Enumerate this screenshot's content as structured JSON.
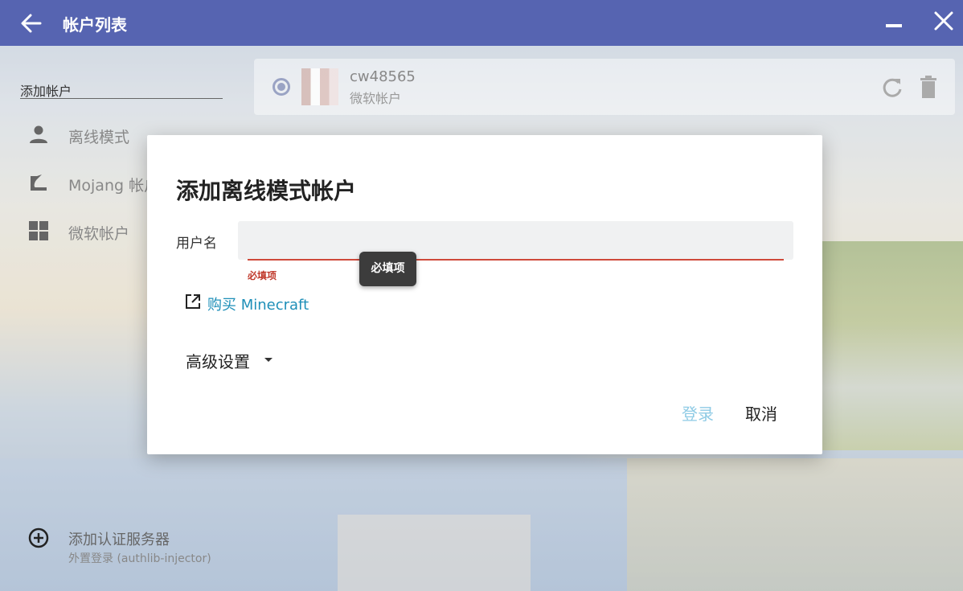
{
  "titlebar": {
    "title": "帐户列表"
  },
  "sidebar": {
    "add_account_label": "添加帐户",
    "items": [
      {
        "label": "离线模式",
        "icon": "person-icon"
      },
      {
        "label": "Mojang 帐户",
        "icon": "mojang-icon"
      },
      {
        "label": "微软帐户",
        "icon": "windows-icon"
      }
    ],
    "add_server": {
      "label": "添加认证服务器",
      "sublabel": "外置登录 (authlib-injector)",
      "icon": "add-circle-icon"
    }
  },
  "account": {
    "name": "cw48565",
    "type": "微软帐户"
  },
  "dialog": {
    "title": "添加离线模式帐户",
    "username_label": "用户名",
    "username_value": "",
    "error_text": "必填项",
    "tooltip_text": "必填项",
    "buy_link": "购买 Minecraft",
    "advanced_label": "高级设置",
    "login_button": "登录",
    "cancel_button": "取消"
  },
  "colors": {
    "titlebar": "#5664b1",
    "error": "#cf4a3b",
    "link": "#1e8fb8",
    "login_disabled": "#8fcbe5"
  }
}
